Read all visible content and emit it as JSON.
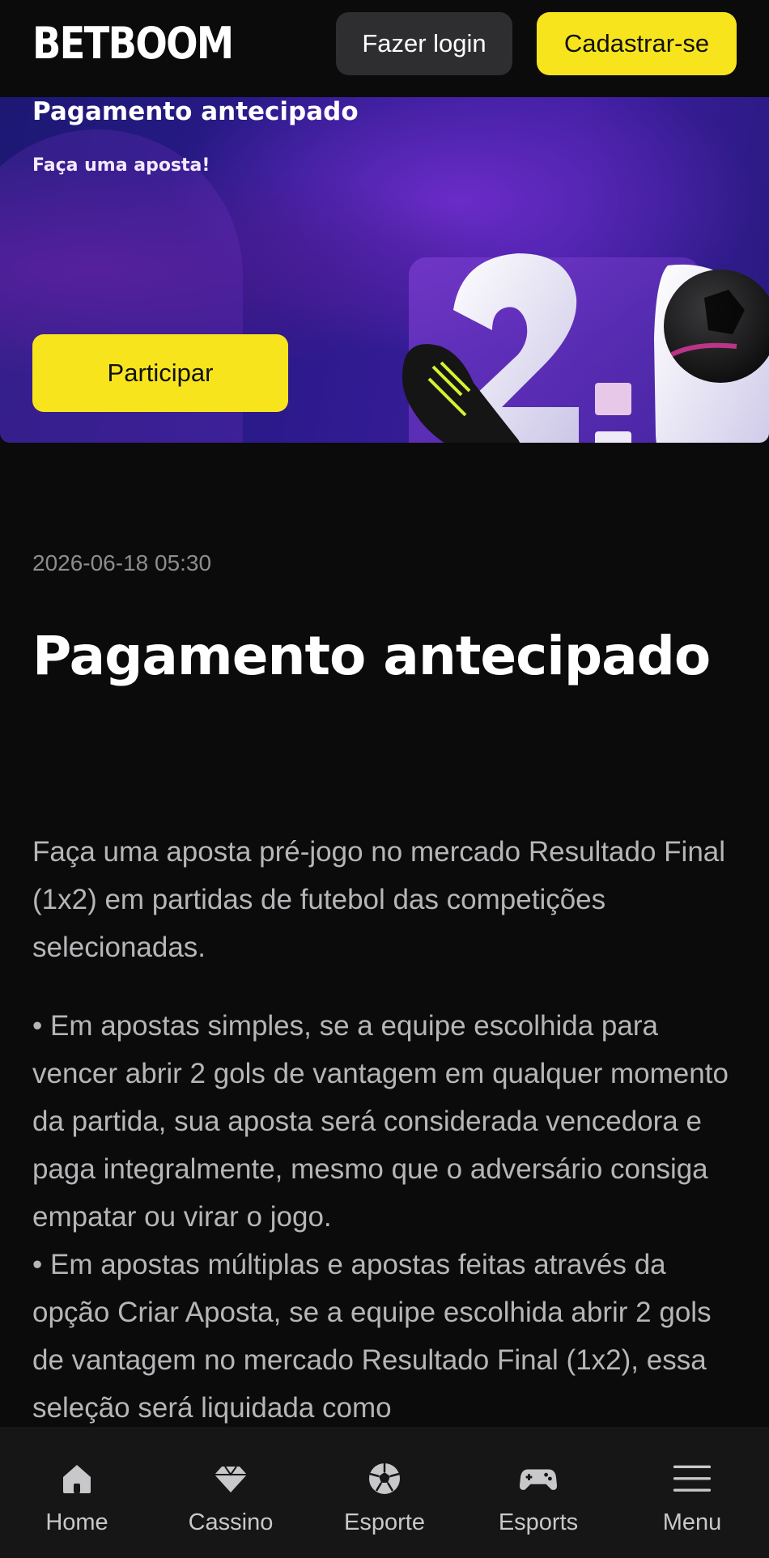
{
  "header": {
    "logo": "BETBOOM",
    "login_label": "Fazer login",
    "register_label": "Cadastrar-se"
  },
  "banner": {
    "title": "Pagamento antecipado",
    "subtitle": "Faça uma aposta!",
    "button_label": "Participar"
  },
  "article": {
    "date": "2026-06-18 05:30",
    "title": "Pagamento antecipado",
    "paragraphs": [
      "Faça uma aposta pré-jogo no mercado Resultado Final (1x2) em partidas de futebol das competições selecionadas.",
      "• Em apostas simples, se a equipe escolhida para vencer abrir 2 gols de vantagem em qualquer momento da partida, sua aposta será considerada vencedora e paga integralmente, mesmo que o adversário consiga empatar ou virar o jogo.",
      "• Em apostas múltiplas e apostas feitas através da opção Criar Aposta, se a equipe escolhida abrir 2 gols de vantagem no mercado Resultado Final (1x2), essa seleção será liquidada como"
    ]
  },
  "bottom_nav": {
    "items": [
      {
        "label": "Home",
        "icon": "home-icon"
      },
      {
        "label": "Cassino",
        "icon": "diamond-icon"
      },
      {
        "label": "Esporte",
        "icon": "soccer-ball-icon"
      },
      {
        "label": "Esports",
        "icon": "gamepad-icon"
      },
      {
        "label": "Menu",
        "icon": "hamburger-icon"
      }
    ]
  },
  "colors": {
    "accent": "#f7e41d",
    "background": "#0b0b0c",
    "banner": "#2c1a8c"
  }
}
